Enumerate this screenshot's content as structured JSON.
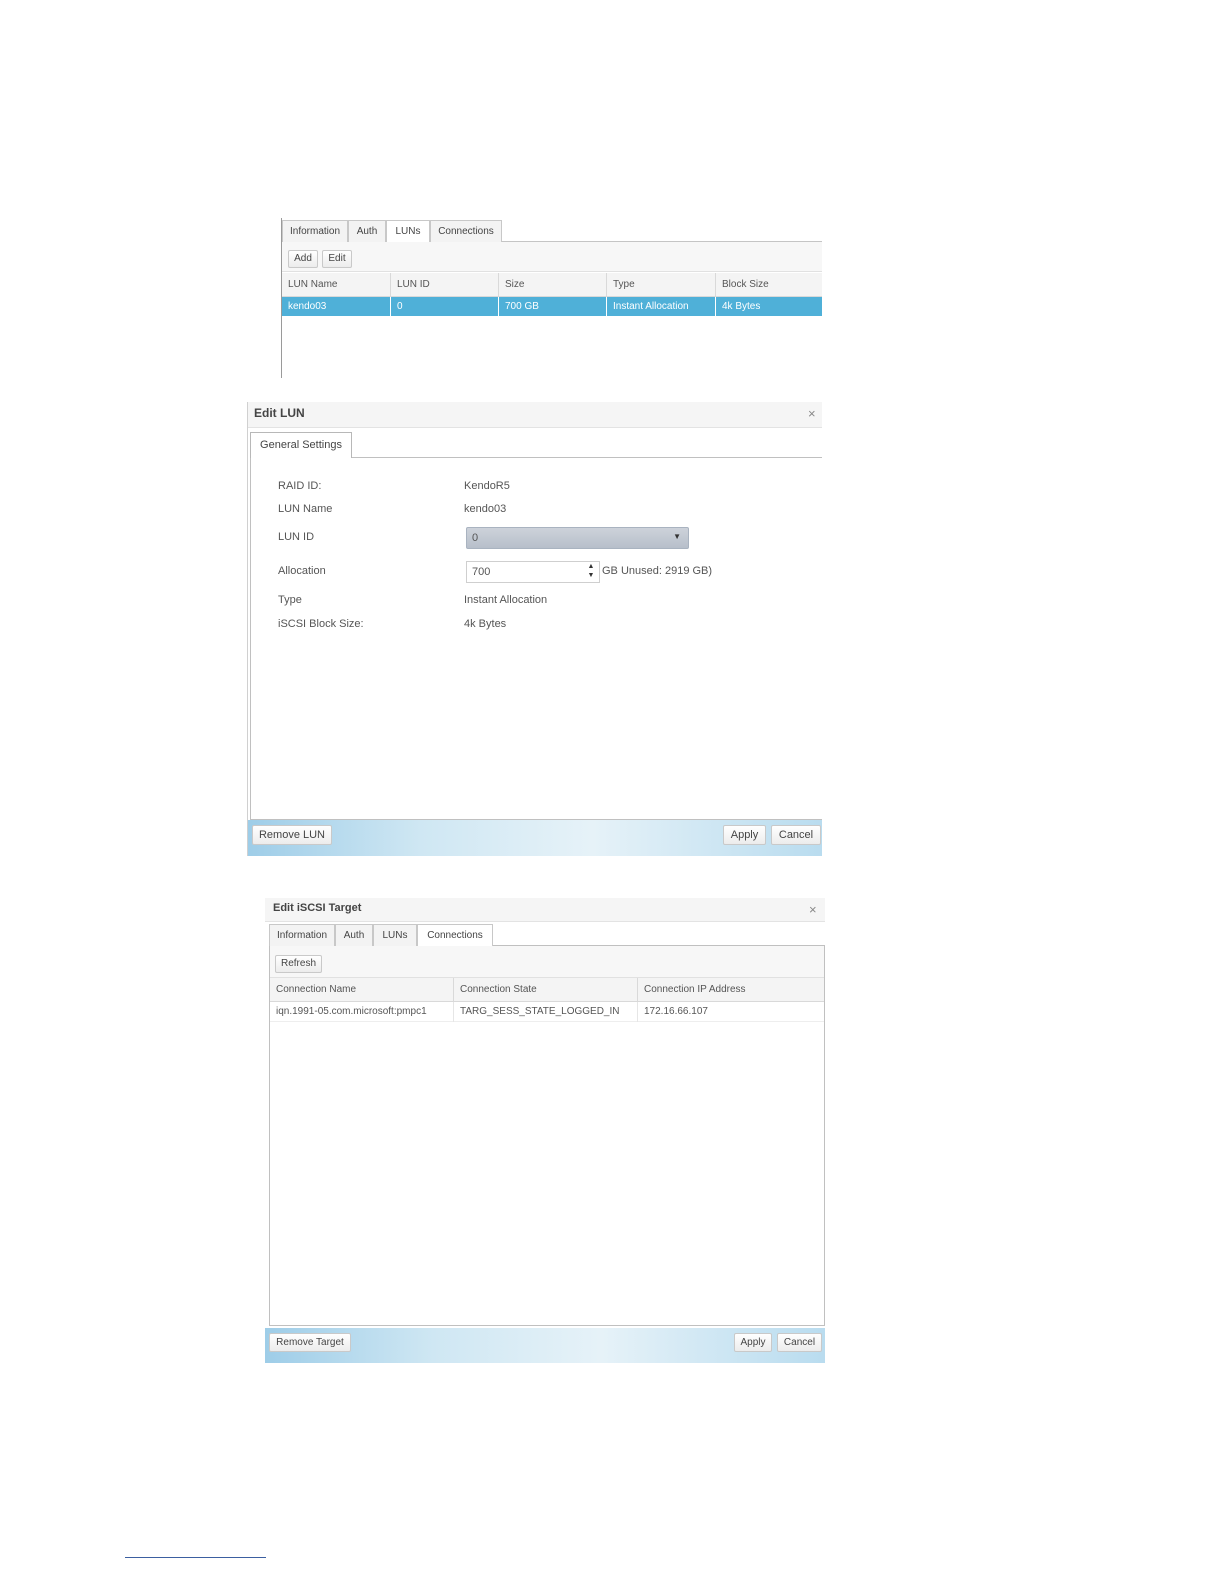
{
  "panel1": {
    "tabs": [
      {
        "label": "Information"
      },
      {
        "label": "Auth"
      },
      {
        "label": "LUNs",
        "active": true
      },
      {
        "label": "Connections"
      }
    ],
    "toolbar": {
      "add_label": "Add",
      "edit_label": "Edit"
    },
    "columns": [
      "LUN Name",
      "LUN ID",
      "Size",
      "Type",
      "Block Size"
    ],
    "rows": [
      {
        "lun_name": "kendo03",
        "lun_id": "0",
        "size": "700 GB",
        "type": "Instant Allocation",
        "block_size": "4k Bytes",
        "selected": true
      }
    ]
  },
  "panel2": {
    "title": "Edit LUN",
    "close_glyph": "×",
    "tab": "General Settings",
    "fields": {
      "raid_id": {
        "label": "RAID ID:",
        "value": "KendoR5"
      },
      "lun_name": {
        "label": "LUN Name",
        "value": "kendo03"
      },
      "lun_id": {
        "label": "LUN ID",
        "value": "0",
        "caret": "▼"
      },
      "allocation": {
        "label": "Allocation",
        "value": "700",
        "suffix": "GB Unused: 2919 GB)",
        "up": "▲",
        "down": "▼"
      },
      "type": {
        "label": "Type",
        "value": "Instant Allocation"
      },
      "block_size": {
        "label": "iSCSI Block Size:",
        "value": "4k Bytes"
      }
    },
    "footer": {
      "remove_label": "Remove LUN",
      "apply_label": "Apply",
      "cancel_label": "Cancel"
    }
  },
  "panel3": {
    "title": "Edit iSCSI Target",
    "close_glyph": "×",
    "tabs": [
      {
        "label": "Information"
      },
      {
        "label": "Auth"
      },
      {
        "label": "LUNs"
      },
      {
        "label": "Connections",
        "active": true
      }
    ],
    "toolbar": {
      "refresh_label": "Refresh"
    },
    "columns": [
      "Connection Name",
      "Connection State",
      "Connection IP Address"
    ],
    "rows": [
      {
        "name": "iqn.1991-05.com.microsoft:pmpc1",
        "state": "TARG_SESS_STATE_LOGGED_IN",
        "ip": "172.16.66.107"
      }
    ],
    "footer": {
      "remove_label": "Remove Target",
      "apply_label": "Apply",
      "cancel_label": "Cancel"
    }
  },
  "colors": {
    "selection": "#4fb0d8",
    "footer_gradient_start": "#9ecde8",
    "footer_gradient_end": "#b9dcef"
  }
}
